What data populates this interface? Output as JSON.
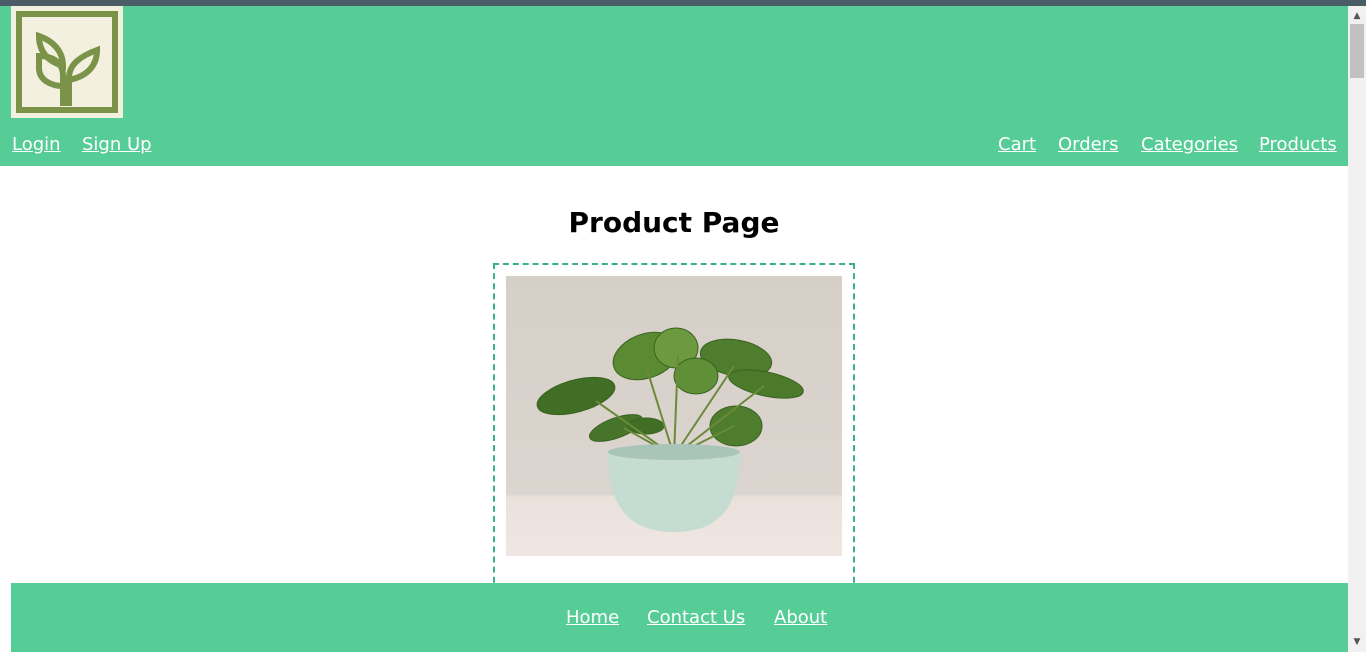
{
  "header": {
    "logo_alt": "plant logo",
    "nav_left": [
      "Login",
      "Sign Up"
    ],
    "nav_right": [
      "Cart",
      "Orders",
      "Categories",
      "Products"
    ]
  },
  "main": {
    "title": "Product Page",
    "product_image": "monstera plant in pot"
  },
  "footer": {
    "links": [
      "Home",
      "Contact Us",
      "About"
    ]
  },
  "colors": {
    "brand_green": "#56cd97",
    "card_border": "#3ab08a",
    "logo_bg": "#f3f0e0",
    "logo_green": "#7a9349"
  },
  "scrollbar": {
    "up_icon": "triangle-up",
    "down_icon": "triangle-down"
  }
}
